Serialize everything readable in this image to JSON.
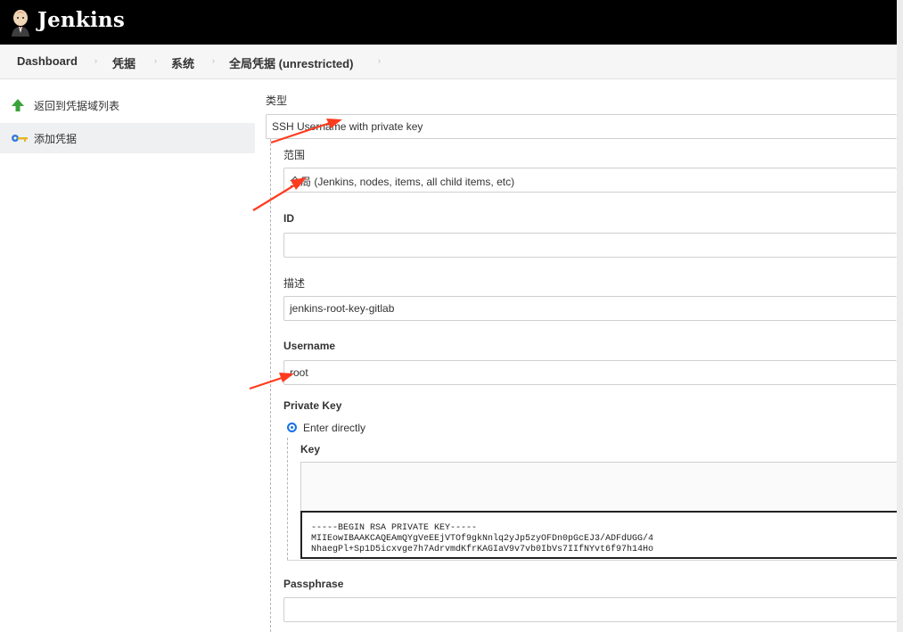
{
  "header": {
    "title": "Jenkins",
    "logo_icon": "jenkins-butler-logo-icon"
  },
  "breadcrumb": {
    "items": [
      "Dashboard",
      "凭据",
      "系统",
      "全局凭据 (unrestricted)"
    ],
    "separator": "›"
  },
  "sidebar": {
    "items": [
      {
        "label": "返回到凭据域列表",
        "icon": "green-up-arrow-icon"
      },
      {
        "label": "添加凭据",
        "icon": "key-icon",
        "active": true
      }
    ]
  },
  "form": {
    "kind_label": "类型",
    "kind_value": "SSH Username with private key",
    "scope_label": "范围",
    "scope_value": "全局 (Jenkins, nodes, items, all child items, etc)",
    "id_label": "ID",
    "id_value": "",
    "description_label": "描述",
    "description_value": "jenkins-root-key-gitlab",
    "username_label": "Username",
    "username_value": "root",
    "private_key_label": "Private Key",
    "enter_directly_label": "Enter directly",
    "key_label": "Key",
    "key_lines": [
      "-----BEGIN RSA PRIVATE KEY-----",
      "MIIEowIBAAKCAQEAmQYgVeEEjVTOf9gkNnlq2yJp5zyOFDn0pGcEJ3/ADFdUGG/4",
      "NhaegPl+Sp1D5icxvge7h7AdrvmdKfrKAGIaV9v7vb0IbVs7IIfNYvt6f97h14Ho"
    ],
    "passphrase_label": "Passphrase",
    "passphrase_value": ""
  },
  "colors": {
    "topbar": "#000000",
    "breadcrumb_bg": "#f6f6f6",
    "sidebar_active": "#eef0f2",
    "radio": "#1a73e8",
    "annotation_arrow": "#ff3b1f"
  }
}
